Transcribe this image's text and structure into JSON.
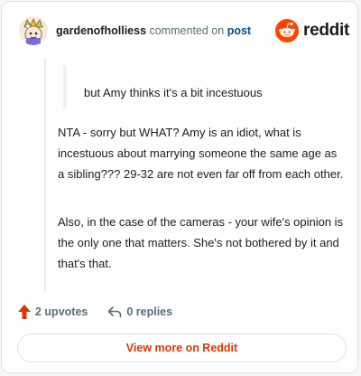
{
  "header": {
    "username": "gardenofholliess",
    "commented_on": "commented on",
    "post_link": "post",
    "brand": "reddit"
  },
  "comment": {
    "quote": "but Amy thinks it's a bit incestuous",
    "paragraphs": [
      "NTA - sorry but WHAT? Amy is an idiot, what is incestuous about marrying someone the same age as a sibling??? 29-32 are not even far off from each other.",
      "Also, in the case of the cameras - your wife's opinion is the only one that matters. She's not bothered by it and that's that."
    ]
  },
  "actions": {
    "upvotes": "2 upvotes",
    "replies": "0 replies"
  },
  "footer": {
    "view_more": "View more on Reddit"
  },
  "colors": {
    "brand_orange": "#ff4500",
    "upvote": "#d93900",
    "link": "#0a4a8a"
  },
  "icons": [
    "avatar",
    "reddit-logo-icon",
    "upvote-arrow-icon",
    "reply-icon"
  ]
}
